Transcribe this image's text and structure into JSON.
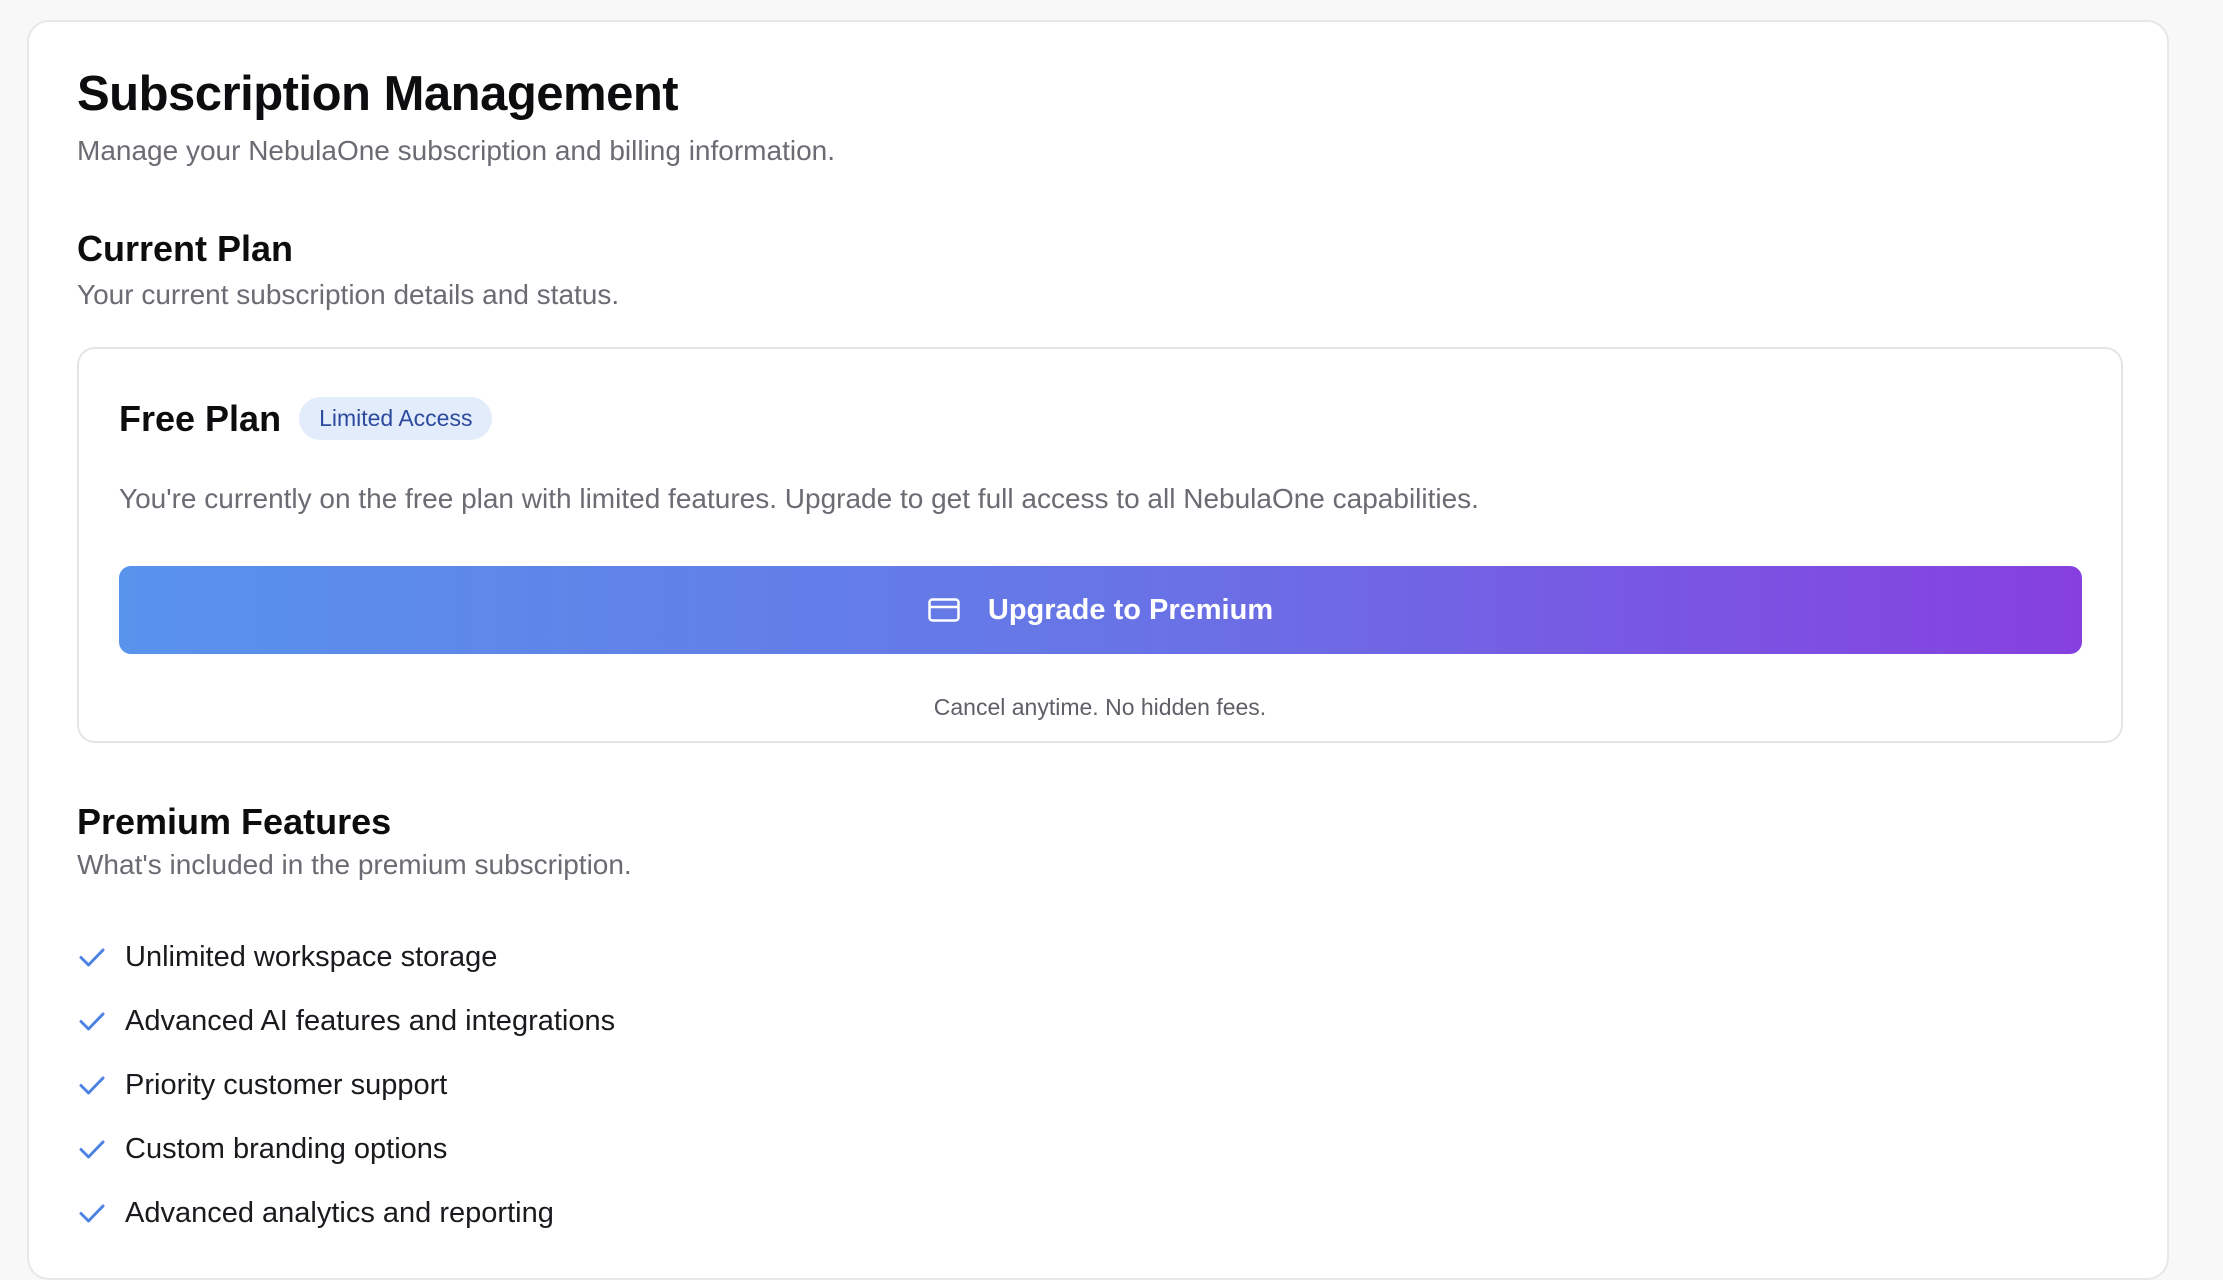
{
  "page": {
    "title": "Subscription Management",
    "subtitle": "Manage your NebulaOne subscription and billing information."
  },
  "current_plan": {
    "title": "Current Plan",
    "subtitle": "Your current subscription details and status.",
    "plan_name": "Free Plan",
    "badge": "Limited Access",
    "description": "You're currently on the free plan with limited features. Upgrade to get full access to all NebulaOne capabilities.",
    "upgrade_button_label": "Upgrade to Premium",
    "upgrade_button_icon": "credit-card-icon",
    "fine_print": "Cancel anytime. No hidden fees."
  },
  "premium_features": {
    "title": "Premium Features",
    "subtitle": "What's included in the premium subscription.",
    "item_icon": "check-icon",
    "items": [
      "Unlimited workspace storage",
      "Advanced AI features and integrations",
      "Priority customer support",
      "Custom branding options",
      "Advanced analytics and reporting"
    ]
  },
  "colors": {
    "accent_start": "#5893ec",
    "accent_end": "#8640e0",
    "check": "#4f83e3",
    "badge_bg": "#e3ecfb",
    "badge_text": "#2c4a9e"
  }
}
